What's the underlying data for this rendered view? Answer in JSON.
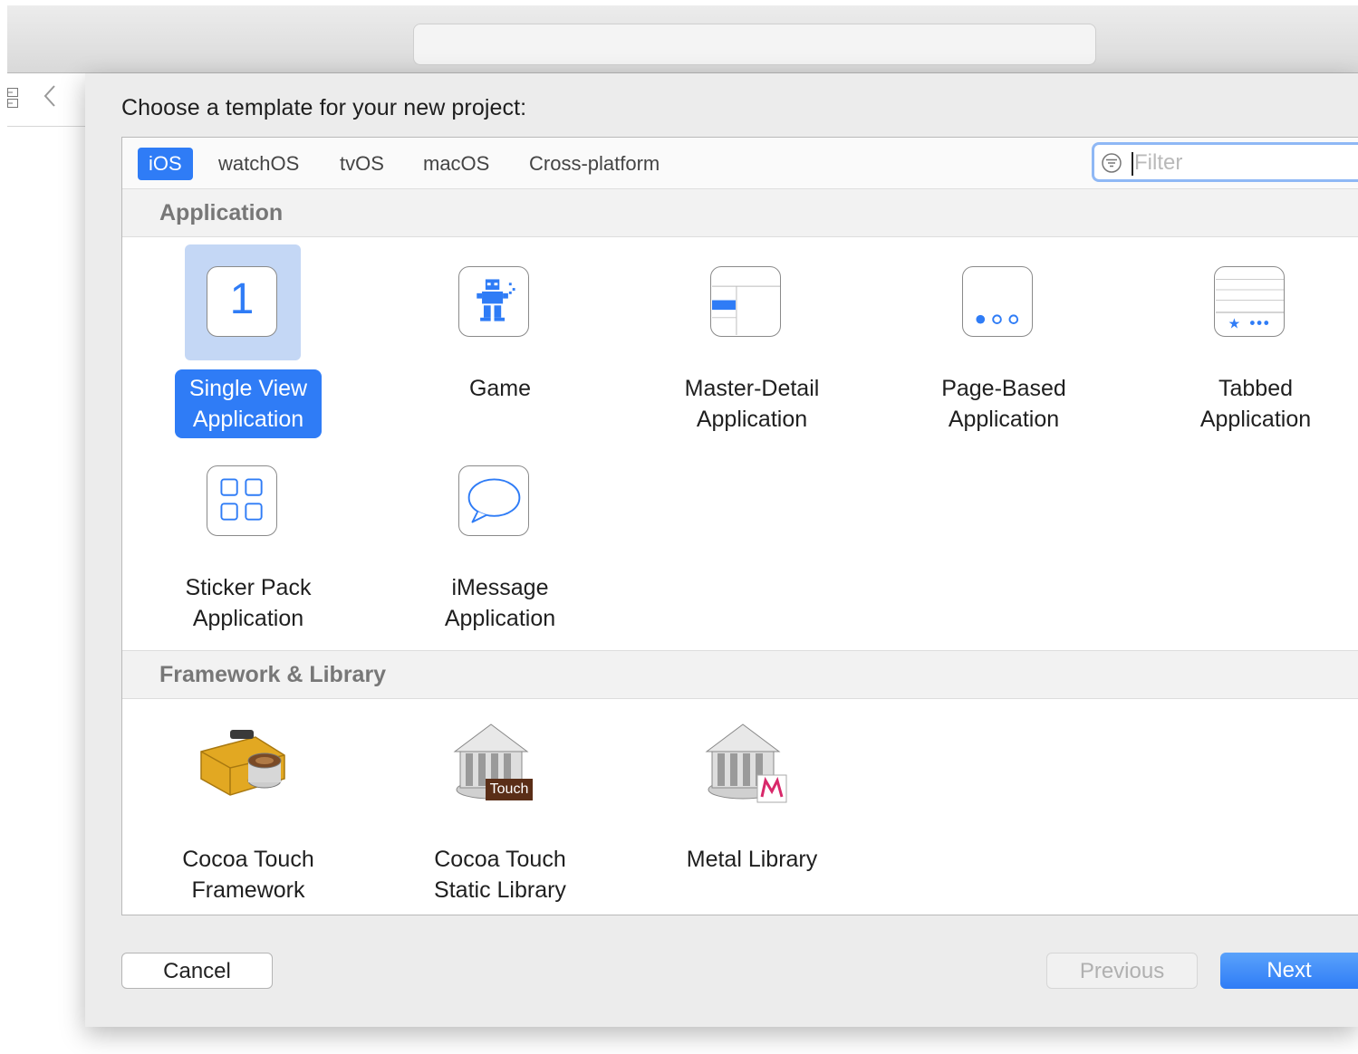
{
  "window": {
    "sheet_title": "Choose a template for your new project:"
  },
  "platform_tabs": [
    {
      "label": "iOS",
      "selected": true
    },
    {
      "label": "watchOS",
      "selected": false
    },
    {
      "label": "tvOS",
      "selected": false
    },
    {
      "label": "macOS",
      "selected": false
    },
    {
      "label": "Cross-platform",
      "selected": false
    }
  ],
  "filter": {
    "placeholder": "Filter",
    "value": "",
    "icon": "filter-icon"
  },
  "sections": [
    {
      "title": "Application",
      "templates": [
        {
          "label": "Single View\nApplication",
          "icon": "single-view-icon",
          "selected": true
        },
        {
          "label": "Game",
          "icon": "game-icon",
          "selected": false
        },
        {
          "label": "Master-Detail\nApplication",
          "icon": "master-detail-icon",
          "selected": false
        },
        {
          "label": "Page-Based\nApplication",
          "icon": "page-based-icon",
          "selected": false
        },
        {
          "label": "Tabbed\nApplication",
          "icon": "tabbed-icon",
          "selected": false
        },
        {
          "label": "Sticker Pack\nApplication",
          "icon": "sticker-pack-icon",
          "selected": false
        },
        {
          "label": "iMessage\nApplication",
          "icon": "imessage-icon",
          "selected": false
        }
      ]
    },
    {
      "title": "Framework & Library",
      "templates": [
        {
          "label": "Cocoa Touch\nFramework",
          "icon": "toolbox-icon",
          "selected": false
        },
        {
          "label": "Cocoa Touch\nStatic Library",
          "icon": "static-library-icon",
          "badge": "Touch",
          "selected": false
        },
        {
          "label": "Metal Library",
          "icon": "metal-library-icon",
          "selected": false
        }
      ]
    }
  ],
  "single_view_icon_text": "1",
  "buttons": {
    "cancel": "Cancel",
    "previous": "Previous",
    "next": "Next"
  },
  "colors": {
    "accent": "#2f7cf6",
    "selection_bg": "#c4d7f5"
  }
}
